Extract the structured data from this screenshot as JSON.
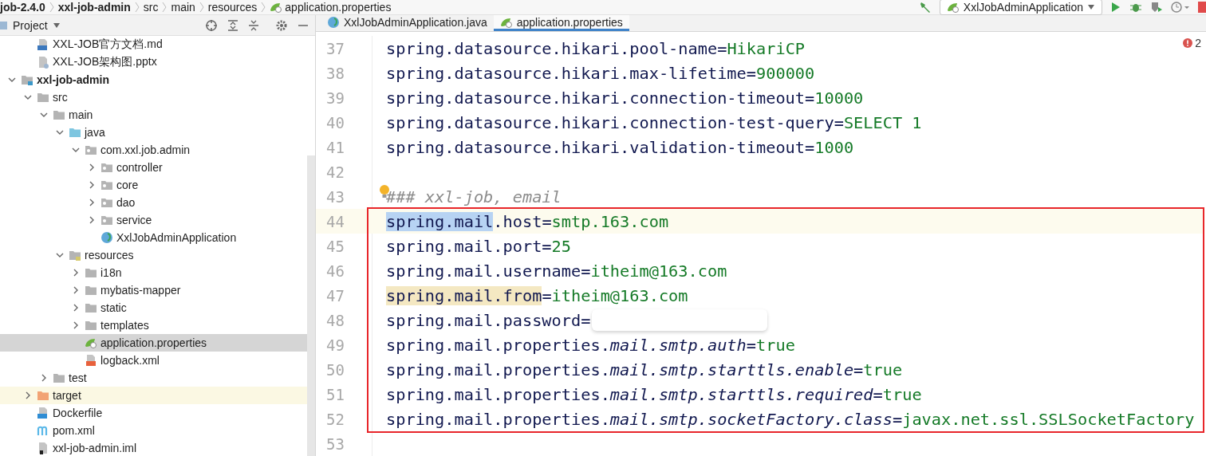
{
  "breadcrumbs": [
    {
      "label": "job-2.4.0",
      "bold": true
    },
    {
      "label": "xxl-job-admin",
      "bold": true
    },
    {
      "label": "src",
      "bold": false
    },
    {
      "label": "main",
      "bold": false
    },
    {
      "label": "resources",
      "bold": false
    },
    {
      "label": "application.properties",
      "bold": false,
      "kind": "properties"
    }
  ],
  "run_config": {
    "label": "XxlJobAdminApplication"
  },
  "project_panel": {
    "title": "Project",
    "doc_files": [
      {
        "label": "XXL-JOB官方文档.md",
        "kind": "md",
        "selected": false
      },
      {
        "label": "XXL-JOB架构图.pptx",
        "kind": "pptx",
        "selected": false
      }
    ],
    "tree": [
      {
        "label": "xxl-job-admin",
        "kind": "module",
        "bold": true,
        "expanded": true,
        "selected": false,
        "children": [
          {
            "label": "src",
            "kind": "folder",
            "expanded": true,
            "selected": false,
            "children": [
              {
                "label": "main",
                "kind": "folder",
                "expanded": true,
                "selected": false,
                "children": [
                  {
                    "label": "java",
                    "kind": "source-folder",
                    "expanded": true,
                    "selected": false,
                    "children": [
                      {
                        "label": "com.xxl.job.admin",
                        "kind": "package",
                        "expanded": true,
                        "selected": false,
                        "children": [
                          {
                            "label": "controller",
                            "kind": "package",
                            "expanded": false,
                            "selected": false
                          },
                          {
                            "label": "core",
                            "kind": "package",
                            "expanded": false,
                            "selected": false
                          },
                          {
                            "label": "dao",
                            "kind": "package",
                            "expanded": false,
                            "selected": false
                          },
                          {
                            "label": "service",
                            "kind": "package",
                            "expanded": false,
                            "selected": false
                          },
                          {
                            "label": "XxlJobAdminApplication",
                            "kind": "class",
                            "selected": false
                          }
                        ]
                      }
                    ]
                  },
                  {
                    "label": "resources",
                    "kind": "resources",
                    "expanded": true,
                    "selected": false,
                    "children": [
                      {
                        "label": "i18n",
                        "kind": "folder",
                        "expanded": false,
                        "selected": false
                      },
                      {
                        "label": "mybatis-mapper",
                        "kind": "folder",
                        "expanded": false,
                        "selected": false
                      },
                      {
                        "label": "static",
                        "kind": "folder",
                        "expanded": false,
                        "selected": false
                      },
                      {
                        "label": "templates",
                        "kind": "folder",
                        "expanded": false,
                        "selected": false
                      },
                      {
                        "label": "application.properties",
                        "kind": "properties",
                        "selected": true
                      },
                      {
                        "label": "logback.xml",
                        "kind": "xml",
                        "selected": false
                      }
                    ]
                  }
                ]
              },
              {
                "label": "test",
                "kind": "folder",
                "expanded": false,
                "selected": false
              }
            ]
          },
          {
            "label": "target",
            "kind": "excluded",
            "expanded": false,
            "selected": false
          },
          {
            "label": "Dockerfile",
            "kind": "docker",
            "selected": false
          },
          {
            "label": "pom.xml",
            "kind": "maven",
            "selected": false
          },
          {
            "label": "xxl-job-admin.iml",
            "kind": "iml",
            "selected": false
          }
        ]
      }
    ]
  },
  "tabs": [
    {
      "label": "XxlJobAdminApplication.java",
      "kind": "class",
      "selected": false
    },
    {
      "label": "application.properties",
      "kind": "properties",
      "selected": true
    }
  ],
  "problems": {
    "count": "2"
  },
  "code_lines": [
    {
      "number": "37",
      "parts": [
        {
          "text": "spring.datasource.hikari.pool-name=",
          "kind": "key"
        },
        {
          "text": "HikariCP",
          "kind": "value"
        }
      ]
    },
    {
      "number": "38",
      "parts": [
        {
          "text": "spring.datasource.hikari.max-lifetime=",
          "kind": "key"
        },
        {
          "text": "900000",
          "kind": "value"
        }
      ]
    },
    {
      "number": "39",
      "parts": [
        {
          "text": "spring.datasource.hikari.connection-timeout=",
          "kind": "key"
        },
        {
          "text": "10000",
          "kind": "value"
        }
      ]
    },
    {
      "number": "40",
      "parts": [
        {
          "text": "spring.datasource.hikari.connection-test-query=",
          "kind": "key"
        },
        {
          "text": "SELECT 1",
          "kind": "value"
        }
      ]
    },
    {
      "number": "41",
      "parts": [
        {
          "text": "spring.datasource.hikari.validation-timeout=",
          "kind": "key"
        },
        {
          "text": "1000",
          "kind": "value"
        }
      ]
    },
    {
      "number": "42"
    },
    {
      "number": "43",
      "bulb": true,
      "parts": [
        {
          "text": "### xxl-job, email",
          "kind": "comment"
        }
      ]
    },
    {
      "number": "44",
      "current": true,
      "boxed": true,
      "parts": [
        {
          "text": "spring.mail",
          "kind": "key",
          "selection": true
        },
        {
          "text": ".host=",
          "kind": "key"
        },
        {
          "text": "smtp.163.com",
          "kind": "value"
        }
      ]
    },
    {
      "number": "45",
      "boxed": true,
      "parts": [
        {
          "text": "spring.mail.port=",
          "kind": "key"
        },
        {
          "text": "25",
          "kind": "value"
        }
      ]
    },
    {
      "number": "46",
      "boxed": true,
      "parts": [
        {
          "text": "spring.mail.username=",
          "kind": "key"
        },
        {
          "text": "itheim@163.com",
          "kind": "value"
        }
      ]
    },
    {
      "number": "47",
      "boxed": true,
      "parts": [
        {
          "text": "spring.mail.from",
          "kind": "key",
          "usage": true
        },
        {
          "text": "=",
          "kind": "key"
        },
        {
          "text": "itheim@163.com",
          "kind": "value"
        }
      ]
    },
    {
      "number": "48",
      "boxed": true,
      "redacted": true,
      "parts": [
        {
          "text": "spring.mail.password=",
          "kind": "key"
        }
      ]
    },
    {
      "number": "49",
      "boxed": true,
      "parts": [
        {
          "text": "spring.mail.properties.",
          "kind": "key"
        },
        {
          "text": "mail.smtp.auth",
          "kind": "italic"
        },
        {
          "text": "=",
          "kind": "key"
        },
        {
          "text": "true",
          "kind": "value"
        }
      ]
    },
    {
      "number": "50",
      "boxed": true,
      "parts": [
        {
          "text": "spring.mail.properties.",
          "kind": "key"
        },
        {
          "text": "mail.smtp.starttls.enable",
          "kind": "italic"
        },
        {
          "text": "=",
          "kind": "key"
        },
        {
          "text": "true",
          "kind": "value"
        }
      ]
    },
    {
      "number": "51",
      "boxed": true,
      "parts": [
        {
          "text": "spring.mail.properties.",
          "kind": "key"
        },
        {
          "text": "mail.smtp.starttls.required",
          "kind": "italic"
        },
        {
          "text": "=",
          "kind": "key"
        },
        {
          "text": "true",
          "kind": "value"
        }
      ]
    },
    {
      "number": "52",
      "boxed": true,
      "parts": [
        {
          "text": "spring.mail.properties.",
          "kind": "key"
        },
        {
          "text": "mail.smtp.socketFactory.class",
          "kind": "italic"
        },
        {
          "text": "=",
          "kind": "key"
        },
        {
          "text": "javax.net.ssl.SSLSocketFactory",
          "kind": "value"
        }
      ]
    },
    {
      "number": "53"
    }
  ]
}
